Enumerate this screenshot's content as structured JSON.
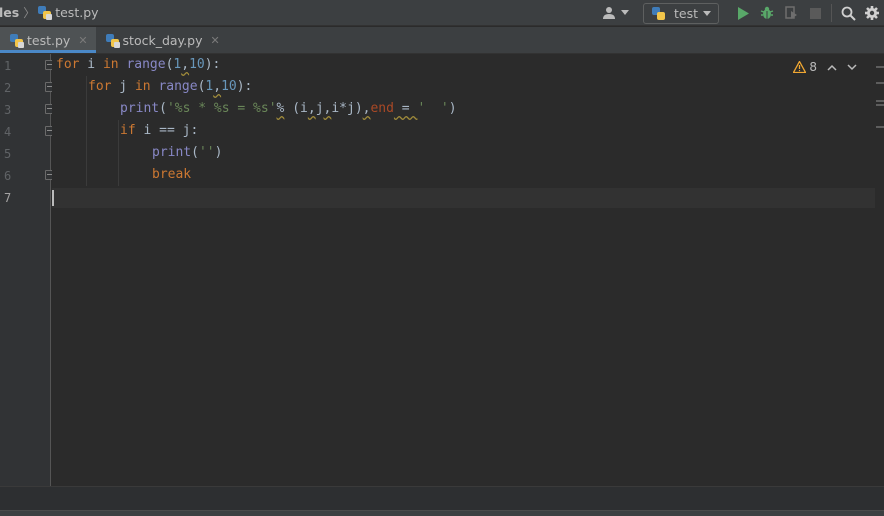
{
  "breadcrumb": {
    "root": "les",
    "file": "test.py"
  },
  "toolbar": {
    "run_config_label": "test"
  },
  "tabs": [
    {
      "label": "test.py",
      "active": true
    },
    {
      "label": "stock_day.py",
      "active": false
    }
  ],
  "editor": {
    "line_numbers": [
      "1",
      "2",
      "3",
      "4",
      "5",
      "6",
      "7"
    ],
    "inspection_warning_count": "8"
  },
  "colors": {
    "keyword": "#cc7832",
    "builtin": "#8888c6",
    "number": "#6897bb",
    "string": "#6a8759",
    "param": "#aa4926",
    "accent": "#4a88c7",
    "run_green": "#59a869",
    "warning": "#f0a732"
  },
  "code": {
    "l1": {
      "t1": "for",
      "t2": " i ",
      "t3": "in",
      "t4": " ",
      "t5": "range",
      "t6": "(",
      "t7": "1",
      "t8": ",",
      "t9": "10",
      "t10": "):"
    },
    "l2": {
      "t1": "for",
      "t2": " j ",
      "t3": "in",
      "t4": " ",
      "t5": "range",
      "t6": "(",
      "t7": "1",
      "t8": ",",
      "t9": "10",
      "t10": "):"
    },
    "l3": {
      "t1": "print",
      "t2": "(",
      "t3": "'%s * %s = %s'",
      "t4": "%",
      "t5": " (i",
      "t6": ",",
      "t7": "j",
      "t8": ",",
      "t9": "i*j)",
      "t10": ",",
      "t11": "end",
      "t12": " = ",
      "t13": "'  '",
      "t14": ")"
    },
    "l4": {
      "t1": "if",
      "t2": " i == j:"
    },
    "l5": {
      "t1": "print",
      "t2": "(",
      "t3": "''",
      "t4": ")"
    },
    "l6": {
      "t1": "break"
    }
  }
}
